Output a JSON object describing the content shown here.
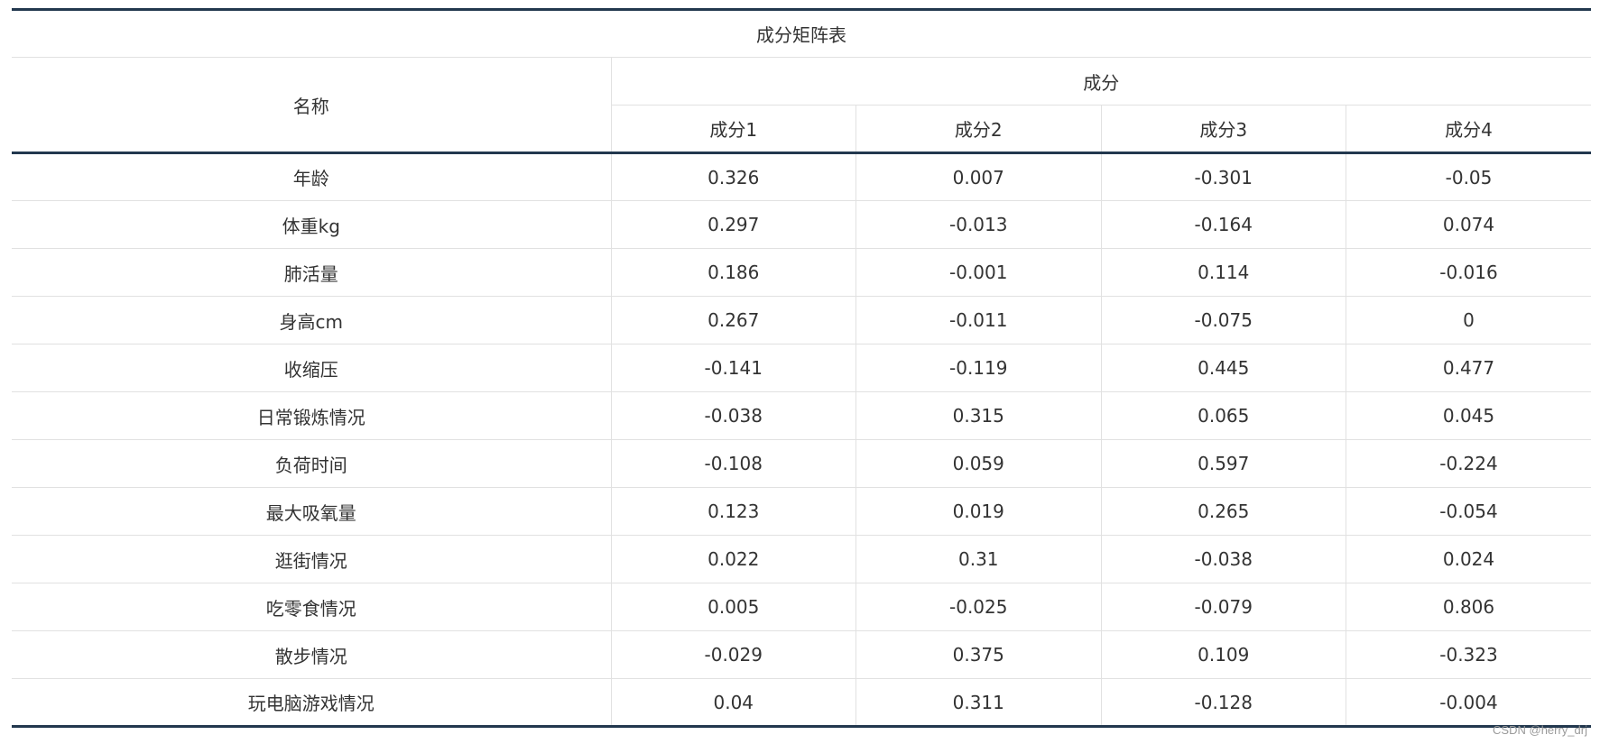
{
  "table": {
    "title": "成分矩阵表",
    "name_header": "名称",
    "group_header": "成分",
    "columns": [
      "成分1",
      "成分2",
      "成分3",
      "成分4"
    ],
    "rows": [
      {
        "name": "年龄",
        "values": [
          "0.326",
          "0.007",
          "-0.301",
          "-0.05"
        ]
      },
      {
        "name": "体重kg",
        "values": [
          "0.297",
          "-0.013",
          "-0.164",
          "0.074"
        ]
      },
      {
        "name": "肺活量",
        "values": [
          "0.186",
          "-0.001",
          "0.114",
          "-0.016"
        ]
      },
      {
        "name": "身高cm",
        "values": [
          "0.267",
          "-0.011",
          "-0.075",
          "0"
        ]
      },
      {
        "name": "收缩压",
        "values": [
          "-0.141",
          "-0.119",
          "0.445",
          "0.477"
        ]
      },
      {
        "name": "日常锻炼情况",
        "values": [
          "-0.038",
          "0.315",
          "0.065",
          "0.045"
        ]
      },
      {
        "name": "负荷时间",
        "values": [
          "-0.108",
          "0.059",
          "0.597",
          "-0.224"
        ]
      },
      {
        "name": "最大吸氧量",
        "values": [
          "0.123",
          "0.019",
          "0.265",
          "-0.054"
        ]
      },
      {
        "name": "逛街情况",
        "values": [
          "0.022",
          "0.31",
          "-0.038",
          "0.024"
        ]
      },
      {
        "name": "吃零食情况",
        "values": [
          "0.005",
          "-0.025",
          "-0.079",
          "0.806"
        ]
      },
      {
        "name": "散步情况",
        "values": [
          "-0.029",
          "0.375",
          "0.109",
          "-0.323"
        ]
      },
      {
        "name": "玩电脑游戏情况",
        "values": [
          "0.04",
          "0.311",
          "-0.128",
          "-0.004"
        ]
      }
    ]
  },
  "watermark": "CSDN @herry_drj"
}
